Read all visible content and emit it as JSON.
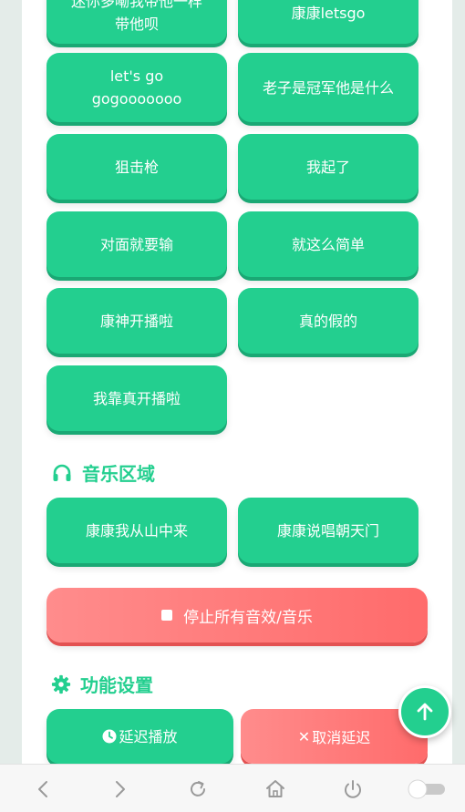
{
  "sound_buttons_top": [
    {
      "label": "迷你多嘞我带他一样\n带他呗"
    },
    {
      "label": "康康letsgo"
    },
    {
      "label": "let's go\ngogooooooo"
    },
    {
      "label": "老子是冠军他是什么"
    },
    {
      "label": "狙击枪"
    },
    {
      "label": "我起了"
    },
    {
      "label": "对面就要输"
    },
    {
      "label": "就这么简单"
    },
    {
      "label": "康神开播啦"
    },
    {
      "label": "真的假的"
    },
    {
      "label": "我靠真开播啦"
    }
  ],
  "music_section": {
    "title": "音乐区域",
    "icon": "headphones-icon",
    "buttons": [
      {
        "label": "康康我从山中来"
      },
      {
        "label": "康康说唱朝天门"
      }
    ]
  },
  "stop_button": {
    "label": "停止所有音效/音乐"
  },
  "settings_section": {
    "title": "功能设置",
    "icon": "gear-icon",
    "delay_label": "延迟播放",
    "cancel_label": "取消延迟"
  },
  "colors": {
    "accent": "#23cf8f",
    "danger": "#ff6b6b"
  },
  "nav_icons": [
    "back-icon",
    "forward-icon",
    "reload-icon",
    "home-icon",
    "power-icon",
    "toggle-icon"
  ]
}
